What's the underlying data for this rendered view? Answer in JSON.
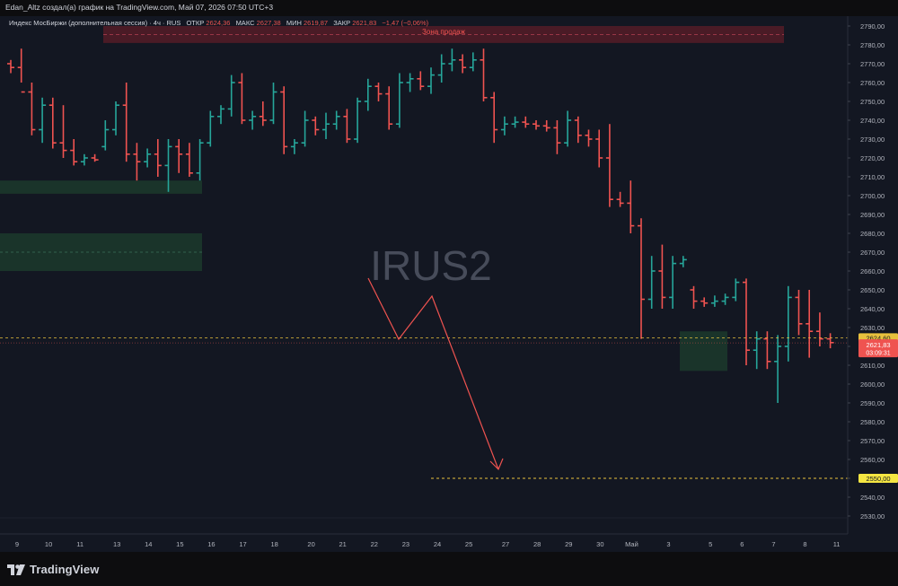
{
  "header": {
    "author_line": "Edan_Altz создал(а) график на TradingView.com, Май 07, 2026 07:50 UTC+3"
  },
  "legend": {
    "instrument": "Индекс МосБиржи (дополнительная сессия) · 4ч · RUS",
    "open_label": "ОТКР",
    "open_value": "2624,36",
    "high_label": "МАКС",
    "high_value": "2627,38",
    "low_label": "МИН",
    "low_value": "2619,87",
    "close_label": "ЗАКР",
    "close_value": "2621,83",
    "change": "−1,47 (−0,06%)"
  },
  "watermark": "IRUS2",
  "zone_label": "Зона продаж",
  "price_badges": {
    "last_price": "2624,60",
    "close_price": "2621,83",
    "countdown": "03:09:31",
    "target_price": "2550,00"
  },
  "footer": {
    "brand": "TradingView"
  },
  "colors": {
    "background": "#131722",
    "up": "#26a69a",
    "down": "#ef5350",
    "zone_red": "#4a1b26",
    "zone_green": "#1c3a2c",
    "dashed_yellow": "#e8c13d",
    "target_badge": "#f5e642",
    "arrow": "#ef5350"
  },
  "chart_data": {
    "type": "ohlc",
    "title": "Индекс МосБиржи (дополнительная сессия) · 4ч · RUS",
    "ylim": [
      2525,
      2795
    ],
    "y_ticks": [
      "2790,00",
      "2780,00",
      "2770,00",
      "2760,00",
      "2750,00",
      "2740,00",
      "2730,00",
      "2720,00",
      "2710,00",
      "2700,00",
      "2690,00",
      "2680,00",
      "2670,00",
      "2660,00",
      "2650,00",
      "2640,00",
      "2630,00",
      "2620,00",
      "2610,00",
      "2600,00",
      "2590,00",
      "2580,00",
      "2570,00",
      "2560,00",
      "2550,00",
      "2540,00",
      "2530,00"
    ],
    "x_ticks": [
      {
        "label": "9",
        "i": 0
      },
      {
        "label": "10",
        "i": 3
      },
      {
        "label": "11",
        "i": 6
      },
      {
        "label": "13",
        "i": 9.5
      },
      {
        "label": "14",
        "i": 12.5
      },
      {
        "label": "15",
        "i": 15.5
      },
      {
        "label": "16",
        "i": 18.5
      },
      {
        "label": "17",
        "i": 21.5
      },
      {
        "label": "18",
        "i": 24.5
      },
      {
        "label": "20",
        "i": 28
      },
      {
        "label": "21",
        "i": 31
      },
      {
        "label": "22",
        "i": 34
      },
      {
        "label": "23",
        "i": 37
      },
      {
        "label": "24",
        "i": 40
      },
      {
        "label": "25",
        "i": 43
      },
      {
        "label": "27",
        "i": 46.5
      },
      {
        "label": "28",
        "i": 49.5
      },
      {
        "label": "29",
        "i": 52.5
      },
      {
        "label": "30",
        "i": 55.5
      },
      {
        "label": "Май",
        "i": 58.5
      },
      {
        "label": "3",
        "i": 62
      },
      {
        "label": "5",
        "i": 66
      },
      {
        "label": "6",
        "i": 69
      },
      {
        "label": "7",
        "i": 72
      },
      {
        "label": "8",
        "i": 75
      },
      {
        "label": "11",
        "i": 78
      }
    ],
    "bars": [
      {
        "o": 2770,
        "h": 2772,
        "l": 2765,
        "c": 2768
      },
      {
        "o": 2768,
        "h": 2778,
        "l": 2760,
        "c": 2755
      },
      {
        "o": 2755,
        "h": 2760,
        "l": 2732,
        "c": 2735
      },
      {
        "o": 2735,
        "h": 2752,
        "l": 2728,
        "c": 2748
      },
      {
        "o": 2748,
        "h": 2752,
        "l": 2725,
        "c": 2728
      },
      {
        "o": 2728,
        "h": 2748,
        "l": 2720,
        "c": 2724
      },
      {
        "o": 2724,
        "h": 2730,
        "l": 2716,
        "c": 2718
      },
      {
        "o": 2718,
        "h": 2722,
        "l": 2716,
        "c": 2720
      },
      {
        "o": 2720,
        "h": 2722,
        "l": 2718,
        "c": 2719
      },
      {
        "o": 2726,
        "h": 2740,
        "l": 2724,
        "c": 2735
      },
      {
        "o": 2735,
        "h": 2750,
        "l": 2732,
        "c": 2748
      },
      {
        "o": 2748,
        "h": 2760,
        "l": 2718,
        "c": 2722
      },
      {
        "o": 2722,
        "h": 2728,
        "l": 2708,
        "c": 2718
      },
      {
        "o": 2718,
        "h": 2725,
        "l": 2715,
        "c": 2722
      },
      {
        "o": 2722,
        "h": 2730,
        "l": 2710,
        "c": 2716
      },
      {
        "o": 2716,
        "h": 2730,
        "l": 2702,
        "c": 2726
      },
      {
        "o": 2726,
        "h": 2730,
        "l": 2712,
        "c": 2722
      },
      {
        "o": 2722,
        "h": 2728,
        "l": 2710,
        "c": 2712
      },
      {
        "o": 2712,
        "h": 2730,
        "l": 2708,
        "c": 2728
      },
      {
        "o": 2728,
        "h": 2745,
        "l": 2726,
        "c": 2742
      },
      {
        "o": 2742,
        "h": 2748,
        "l": 2738,
        "c": 2746
      },
      {
        "o": 2746,
        "h": 2764,
        "l": 2742,
        "c": 2760
      },
      {
        "o": 2760,
        "h": 2765,
        "l": 2738,
        "c": 2740
      },
      {
        "o": 2740,
        "h": 2745,
        "l": 2735,
        "c": 2742
      },
      {
        "o": 2742,
        "h": 2750,
        "l": 2737,
        "c": 2740
      },
      {
        "o": 2740,
        "h": 2760,
        "l": 2738,
        "c": 2755
      },
      {
        "o": 2755,
        "h": 2758,
        "l": 2722,
        "c": 2726
      },
      {
        "o": 2726,
        "h": 2730,
        "l": 2722,
        "c": 2728
      },
      {
        "o": 2728,
        "h": 2745,
        "l": 2726,
        "c": 2740
      },
      {
        "o": 2740,
        "h": 2742,
        "l": 2732,
        "c": 2735
      },
      {
        "o": 2735,
        "h": 2744,
        "l": 2730,
        "c": 2738
      },
      {
        "o": 2738,
        "h": 2745,
        "l": 2735,
        "c": 2742
      },
      {
        "o": 2742,
        "h": 2746,
        "l": 2728,
        "c": 2730
      },
      {
        "o": 2730,
        "h": 2752,
        "l": 2728,
        "c": 2750
      },
      {
        "o": 2750,
        "h": 2762,
        "l": 2745,
        "c": 2758
      },
      {
        "o": 2758,
        "h": 2760,
        "l": 2750,
        "c": 2754
      },
      {
        "o": 2754,
        "h": 2758,
        "l": 2735,
        "c": 2738
      },
      {
        "o": 2738,
        "h": 2765,
        "l": 2736,
        "c": 2760
      },
      {
        "o": 2760,
        "h": 2765,
        "l": 2755,
        "c": 2762
      },
      {
        "o": 2762,
        "h": 2766,
        "l": 2756,
        "c": 2758
      },
      {
        "o": 2758,
        "h": 2768,
        "l": 2754,
        "c": 2764
      },
      {
        "o": 2764,
        "h": 2775,
        "l": 2760,
        "c": 2770
      },
      {
        "o": 2770,
        "h": 2778,
        "l": 2766,
        "c": 2772
      },
      {
        "o": 2772,
        "h": 2775,
        "l": 2765,
        "c": 2768
      },
      {
        "o": 2768,
        "h": 2776,
        "l": 2766,
        "c": 2772
      },
      {
        "o": 2772,
        "h": 2778,
        "l": 2750,
        "c": 2752
      },
      {
        "o": 2752,
        "h": 2755,
        "l": 2728,
        "c": 2735
      },
      {
        "o": 2735,
        "h": 2742,
        "l": 2732,
        "c": 2738
      },
      {
        "o": 2738,
        "h": 2742,
        "l": 2736,
        "c": 2739
      },
      {
        "o": 2739,
        "h": 2742,
        "l": 2736,
        "c": 2738
      },
      {
        "o": 2738,
        "h": 2740,
        "l": 2735,
        "c": 2737
      },
      {
        "o": 2737,
        "h": 2740,
        "l": 2734,
        "c": 2736
      },
      {
        "o": 2736,
        "h": 2740,
        "l": 2722,
        "c": 2728
      },
      {
        "o": 2728,
        "h": 2745,
        "l": 2726,
        "c": 2740
      },
      {
        "o": 2740,
        "h": 2742,
        "l": 2728,
        "c": 2732
      },
      {
        "o": 2732,
        "h": 2735,
        "l": 2726,
        "c": 2730
      },
      {
        "o": 2730,
        "h": 2735,
        "l": 2715,
        "c": 2720
      },
      {
        "o": 2720,
        "h": 2738,
        "l": 2694,
        "c": 2698
      },
      {
        "o": 2698,
        "h": 2702,
        "l": 2694,
        "c": 2696
      },
      {
        "o": 2696,
        "h": 2708,
        "l": 2680,
        "c": 2684
      },
      {
        "o": 2684,
        "h": 2688,
        "l": 2624,
        "c": 2645
      },
      {
        "o": 2645,
        "h": 2668,
        "l": 2640,
        "c": 2660
      },
      {
        "o": 2660,
        "h": 2674,
        "l": 2640,
        "c": 2646
      },
      {
        "o": 2646,
        "h": 2668,
        "l": 2640,
        "c": 2664
      },
      {
        "o": 2664,
        "h": 2668,
        "l": 2662,
        "c": 2666
      },
      {
        "o": 2650,
        "h": 2652,
        "l": 2640,
        "c": 2644
      },
      {
        "o": 2644,
        "h": 2646,
        "l": 2641,
        "c": 2643
      },
      {
        "o": 2643,
        "h": 2647,
        "l": 2641,
        "c": 2644
      },
      {
        "o": 2644,
        "h": 2648,
        "l": 2642,
        "c": 2646
      },
      {
        "o": 2646,
        "h": 2656,
        "l": 2644,
        "c": 2654
      },
      {
        "o": 2654,
        "h": 2656,
        "l": 2610,
        "c": 2618
      },
      {
        "o": 2618,
        "h": 2628,
        "l": 2608,
        "c": 2624
      },
      {
        "o": 2624,
        "h": 2628,
        "l": 2608,
        "c": 2612
      },
      {
        "o": 2612,
        "h": 2626,
        "l": 2590,
        "c": 2620
      },
      {
        "o": 2620,
        "h": 2652,
        "l": 2612,
        "c": 2646
      },
      {
        "o": 2646,
        "h": 2650,
        "l": 2626,
        "c": 2632
      },
      {
        "o": 2632,
        "h": 2650,
        "l": 2614,
        "c": 2628
      },
      {
        "o": 2628,
        "h": 2638,
        "l": 2620,
        "c": 2624
      },
      {
        "o": 2624,
        "h": 2627,
        "l": 2619,
        "c": 2622
      }
    ],
    "sell_zone": {
      "from": 2781,
      "to": 2790
    },
    "green_zones": [
      {
        "from": 2701,
        "to": 2708
      },
      {
        "from": 2660,
        "to": 2680
      },
      {
        "from": 2607,
        "to": 2628
      }
    ],
    "current_price": 2624.6,
    "target_price": 2550
  }
}
